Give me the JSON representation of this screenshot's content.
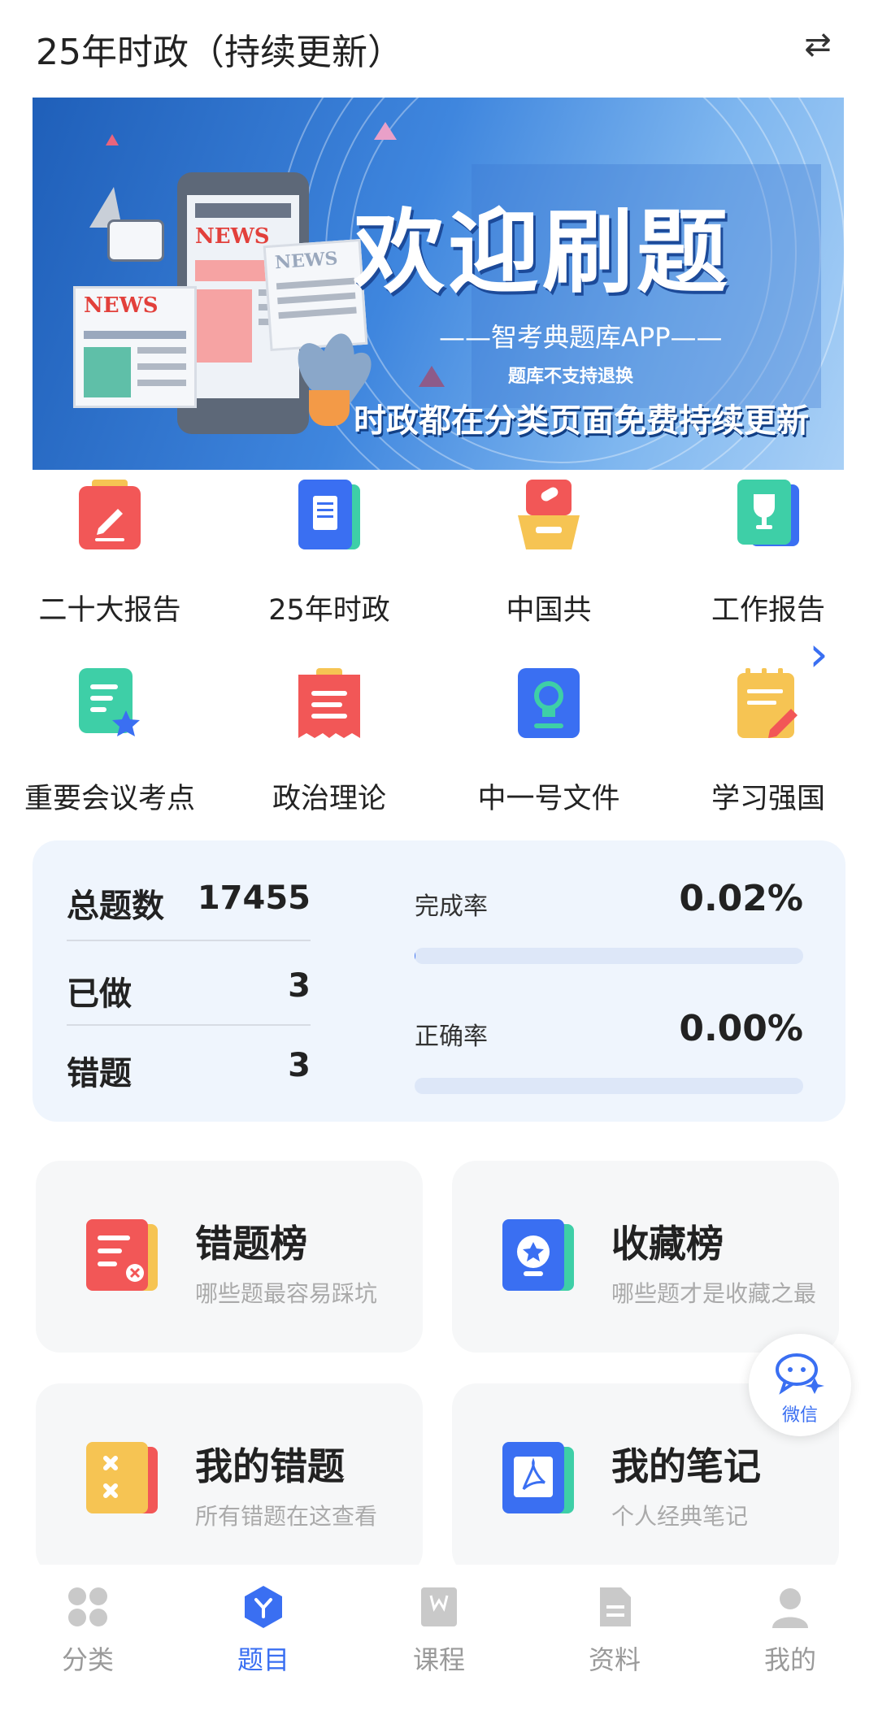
{
  "header": {
    "title": "25年时政（持续更新）",
    "swap_icon": "swap-icon"
  },
  "banner": {
    "headline": "欢迎刷题",
    "subtitle": "——智考典题库APP——",
    "note": "题库不支持退换",
    "tagline": "时政都在分类页面免费持续更新",
    "news_label_1": "NEWS",
    "news_label_2": "NEWS",
    "news_label_3": "NEWS",
    "colors": {
      "primary": "#2f74d0",
      "light": "#a9d0f6"
    }
  },
  "categories": [
    {
      "label": "二十大报告",
      "icon": "report-pencil-icon",
      "color": "#f25757"
    },
    {
      "label": "25年时政",
      "icon": "document-icon",
      "color": "#3a6ff2"
    },
    {
      "label": "中国共",
      "icon": "scroll-box-icon",
      "color": "#f5c242"
    },
    {
      "label": "工作报告",
      "icon": "trophy-icon",
      "color": "#3ecfa7"
    },
    {
      "label": "重要会议考点",
      "icon": "note-star-icon",
      "color": "#3ecfa7"
    },
    {
      "label": "政治理论",
      "icon": "clipboard-icon",
      "color": "#f25757"
    },
    {
      "label": "中一号文件",
      "icon": "bulb-book-icon",
      "color": "#3a6ff2"
    },
    {
      "label": "学习强国",
      "icon": "notepad-pencil-icon",
      "color": "#f5c242"
    }
  ],
  "more_icon": "chevron-right-icon",
  "stats": {
    "total_label": "总题数",
    "total_value": "17455",
    "done_label": "已做",
    "done_value": "3",
    "wrong_label": "错题",
    "wrong_value": "3",
    "completion_label": "完成率",
    "completion_value": "0.02%",
    "completion_fraction": 0.0002,
    "accuracy_label": "正确率",
    "accuracy_value": "0.00%",
    "accuracy_fraction": 0.0
  },
  "cards": [
    {
      "title": "错题榜",
      "subtitle": "哪些题最容易踩坑",
      "icon": "wrong-list-icon"
    },
    {
      "title": "收藏榜",
      "subtitle": "哪些题才是收藏之最",
      "icon": "favorite-star-icon"
    },
    {
      "title": "我的错题",
      "subtitle": "所有错题在这查看",
      "icon": "wrong-x-icon"
    },
    {
      "title": "我的笔记",
      "subtitle": "个人经典笔记",
      "icon": "note-pdf-icon"
    }
  ],
  "wechat": {
    "label": "微信",
    "icon": "wechat-chat-icon"
  },
  "tabs": [
    {
      "label": "分类",
      "icon": "grid-icon",
      "active": false
    },
    {
      "label": "题目",
      "icon": "hexagon-y-icon",
      "active": true
    },
    {
      "label": "课程",
      "icon": "book-w-icon",
      "active": false
    },
    {
      "label": "资料",
      "icon": "file-icon",
      "active": false
    },
    {
      "label": "我的",
      "icon": "user-icon",
      "active": false
    }
  ]
}
